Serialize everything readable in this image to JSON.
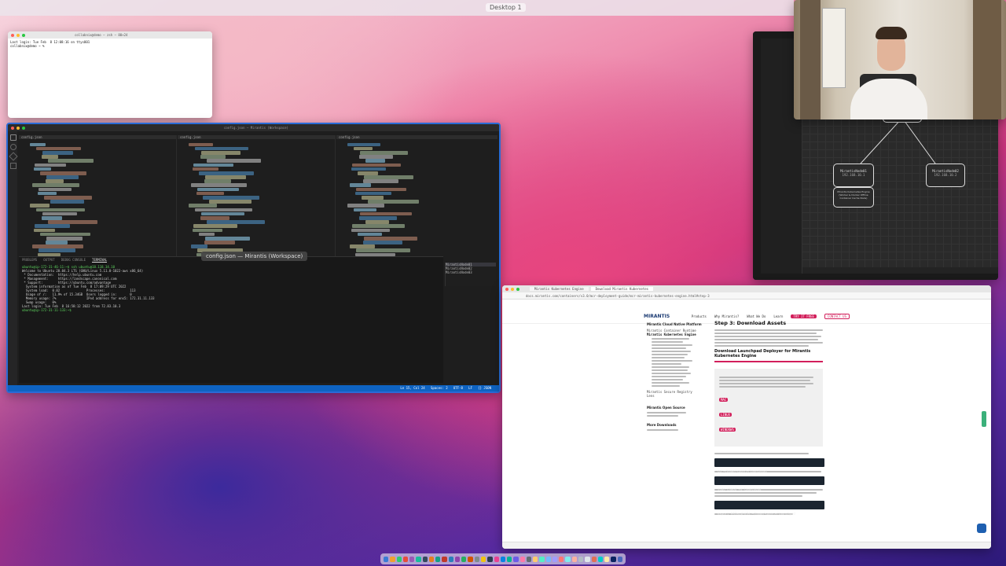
{
  "desktop": {
    "label": "Desktop 1"
  },
  "terminal_small": {
    "title": "collabnix@demo — zsh — 80×24",
    "line1": "Last login: Tue Feb  8 12:08:16 on ttys001",
    "line2": "collabnix@demo ~ %"
  },
  "vscode": {
    "title": "config.json — Mirantis (Workspace)",
    "tooltip": "config.json — Mirantis (Workspace)",
    "tabs": [
      "config.json",
      "config.json",
      "config.json"
    ],
    "panel_tabs": [
      "PROBLEMS",
      "OUTPUT",
      "DEBUG CONSOLE",
      "TERMINAL"
    ],
    "terminal_lines": [
      "ubuntu@ip-172-31-46-11:~$ ssh ubuntu@18.118.34.10",
      "Welcome to Ubuntu 20.04.3 LTS (GNU/Linux 5.11.0-1022-aws x86_64)",
      "",
      " * Documentation:  https://help.ubuntu.com",
      " * Management:     https://landscape.canonical.com",
      " * Support:        https://ubuntu.com/advantage",
      "",
      "  System information as of Tue Feb  8 17:09:29 UTC 2022",
      "",
      "  System load:  0.02              Processes:             113",
      "  Usage of /:   11.9% of 15.34GB  Users logged in:       0",
      "  Memory usage: 7%                IPv4 address for ens5: 172.31.11.133",
      "  Swap usage:   0%",
      "",
      "Last login: Tue Feb  8 16:58:12 2022 from 72.83.10.3",
      "ubuntu@ip-172-31-11-133:~$"
    ],
    "panel_list": [
      "MirantisNode01",
      "MirantisNode02",
      "MirantisNode03"
    ],
    "status_right": "Ln 15, Col 24   Spaces: 2   UTF-8   LF   {} JSON"
  },
  "diagram": {
    "node_left_title": "MirantisNode01",
    "node_left_ip": "192.168.10.1",
    "node_left_label": "Mirantis Kubernetes Engine (Worker & Docker Offline Container Cache Node)",
    "node_right_title": "MirantisNode02",
    "node_right_ip": "192.168.10.2"
  },
  "browser": {
    "tabs": [
      "Mirantis Kubernetes Engine",
      "Download Mirantis Kubernetes"
    ],
    "url": "docs.mirantis.com/containers/v3.0/mcr-deployment-guide/mcr-mirantis-kubernetes-engine.html#step-3",
    "nav": {
      "logo": "MIRANTIS",
      "items": [
        "Products",
        "Why Mirantis?",
        "What We Do",
        "Learn"
      ],
      "cta1": "TRY IT FREE",
      "cta2": "CONTACT US"
    },
    "sidebar": {
      "section1": "Mirantis Cloud Native Platform",
      "items1": [
        "Mirantis Container Runtime",
        "Mirantis Kubernetes Engine",
        "Mirantis Secure Registry",
        "Lens"
      ],
      "section2": "Mirantis Open Source",
      "section3": "More Downloads"
    },
    "heading": "Step 3: Download Assets",
    "subheading": "Download Launchpad Deployer for Mirantis Kubernetes Engine",
    "buttons": [
      "MAC",
      "LINUX",
      "WINDOWS"
    ],
    "code1": "cd ~/home/<user>/launchpad",
    "code2": "sudo chmod +x launchpad",
    "code3": "export PATH=$PATH:~/home/<user>/launchpad"
  },
  "colors": {
    "accent": "#d21f5b",
    "vscode_status": "#0e63c2",
    "vscode_border": "#2a6bd6"
  }
}
